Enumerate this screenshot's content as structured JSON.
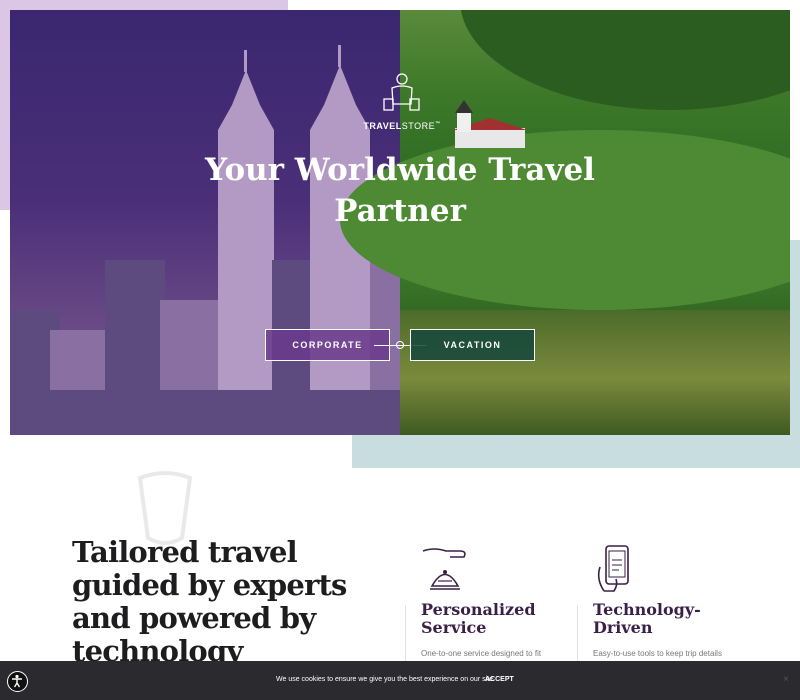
{
  "hero": {
    "logo": {
      "name_bold": "TRAVEL",
      "name_light": "STORE",
      "mark": "™"
    },
    "title_line1": "Your Worldwide Travel",
    "title_line2": "Partner",
    "buttons": {
      "corporate": "CORPORATE",
      "vacation": "VACATION"
    }
  },
  "intro": {
    "tagline_lines": [
      "Tailored travel",
      "guided by experts",
      "and powered by",
      "technology"
    ]
  },
  "features": [
    {
      "icon": "concierge-bell-icon",
      "title_line1": "Personalized",
      "title_line2": "Service",
      "description": "One-to-one service designed to fit"
    },
    {
      "icon": "smartphone-hand-icon",
      "title_line1": "Technology-",
      "title_line2": "Driven",
      "description": "Easy-to-use tools to keep trip details"
    }
  ],
  "cookie": {
    "message": "We use cookies to ensure we give you the best experience on our site.",
    "accept_label": "ACCEPT",
    "close_label": "×"
  },
  "colors": {
    "hero_purple": "#4a2f78",
    "hero_green": "#3f7a2a",
    "corporate_button": "#6a3a8c",
    "vacation_button": "#14463c",
    "feature_title": "#3a1f47",
    "teal_block": "#c8dde0",
    "lavender_block": "#dcc6e6",
    "cookie_bar": "#2b2b2f"
  }
}
